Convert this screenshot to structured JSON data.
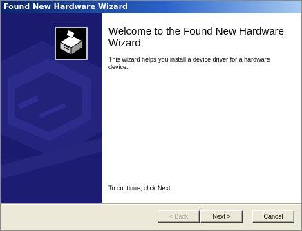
{
  "window": {
    "title": "Found New Hardware Wizard"
  },
  "sidebar": {
    "icon": "hardware-device-icon",
    "background_color": "#1a1a6e"
  },
  "content": {
    "title": "Welcome to the Found New Hardware Wizard",
    "description": "This wizard helps you install a device driver for a hardware device.",
    "continue_text": "To continue, click Next."
  },
  "buttons": {
    "back_label": "< Back",
    "back_enabled": false,
    "next_label": "Next >",
    "cancel_label": "Cancel"
  }
}
